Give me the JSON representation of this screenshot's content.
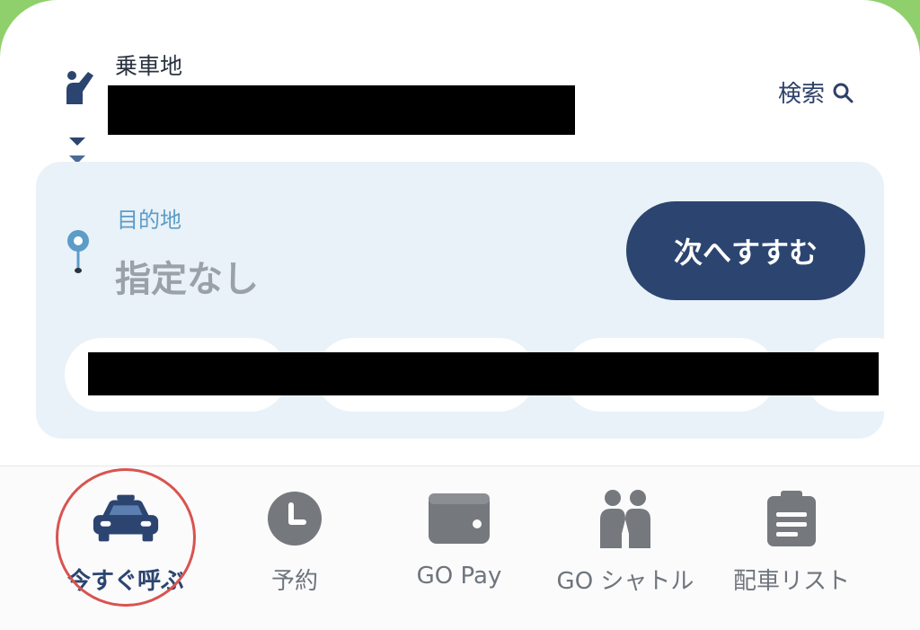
{
  "pickup": {
    "label": "乗車地"
  },
  "search": {
    "label": "検索",
    "icon": "search-icon"
  },
  "destination": {
    "label": "目的地",
    "value": "指定なし"
  },
  "next_button": {
    "label": "次へすすむ"
  },
  "tabs": [
    {
      "label": "今すぐ呼ぶ",
      "icon": "taxi-icon",
      "active": true
    },
    {
      "label": "予約",
      "icon": "clock-icon"
    },
    {
      "label": "GO Pay",
      "icon": "wallet-icon"
    },
    {
      "label": "GO シャトル",
      "icon": "people-icon"
    },
    {
      "label": "配車リスト",
      "icon": "clipboard-icon"
    }
  ],
  "colors": {
    "brand_navy": "#2c4570",
    "destination_bg": "#e9f2f8",
    "destination_label": "#5b9cc8",
    "header_green": "#8fd06c",
    "highlight_ring": "#d9534f"
  }
}
